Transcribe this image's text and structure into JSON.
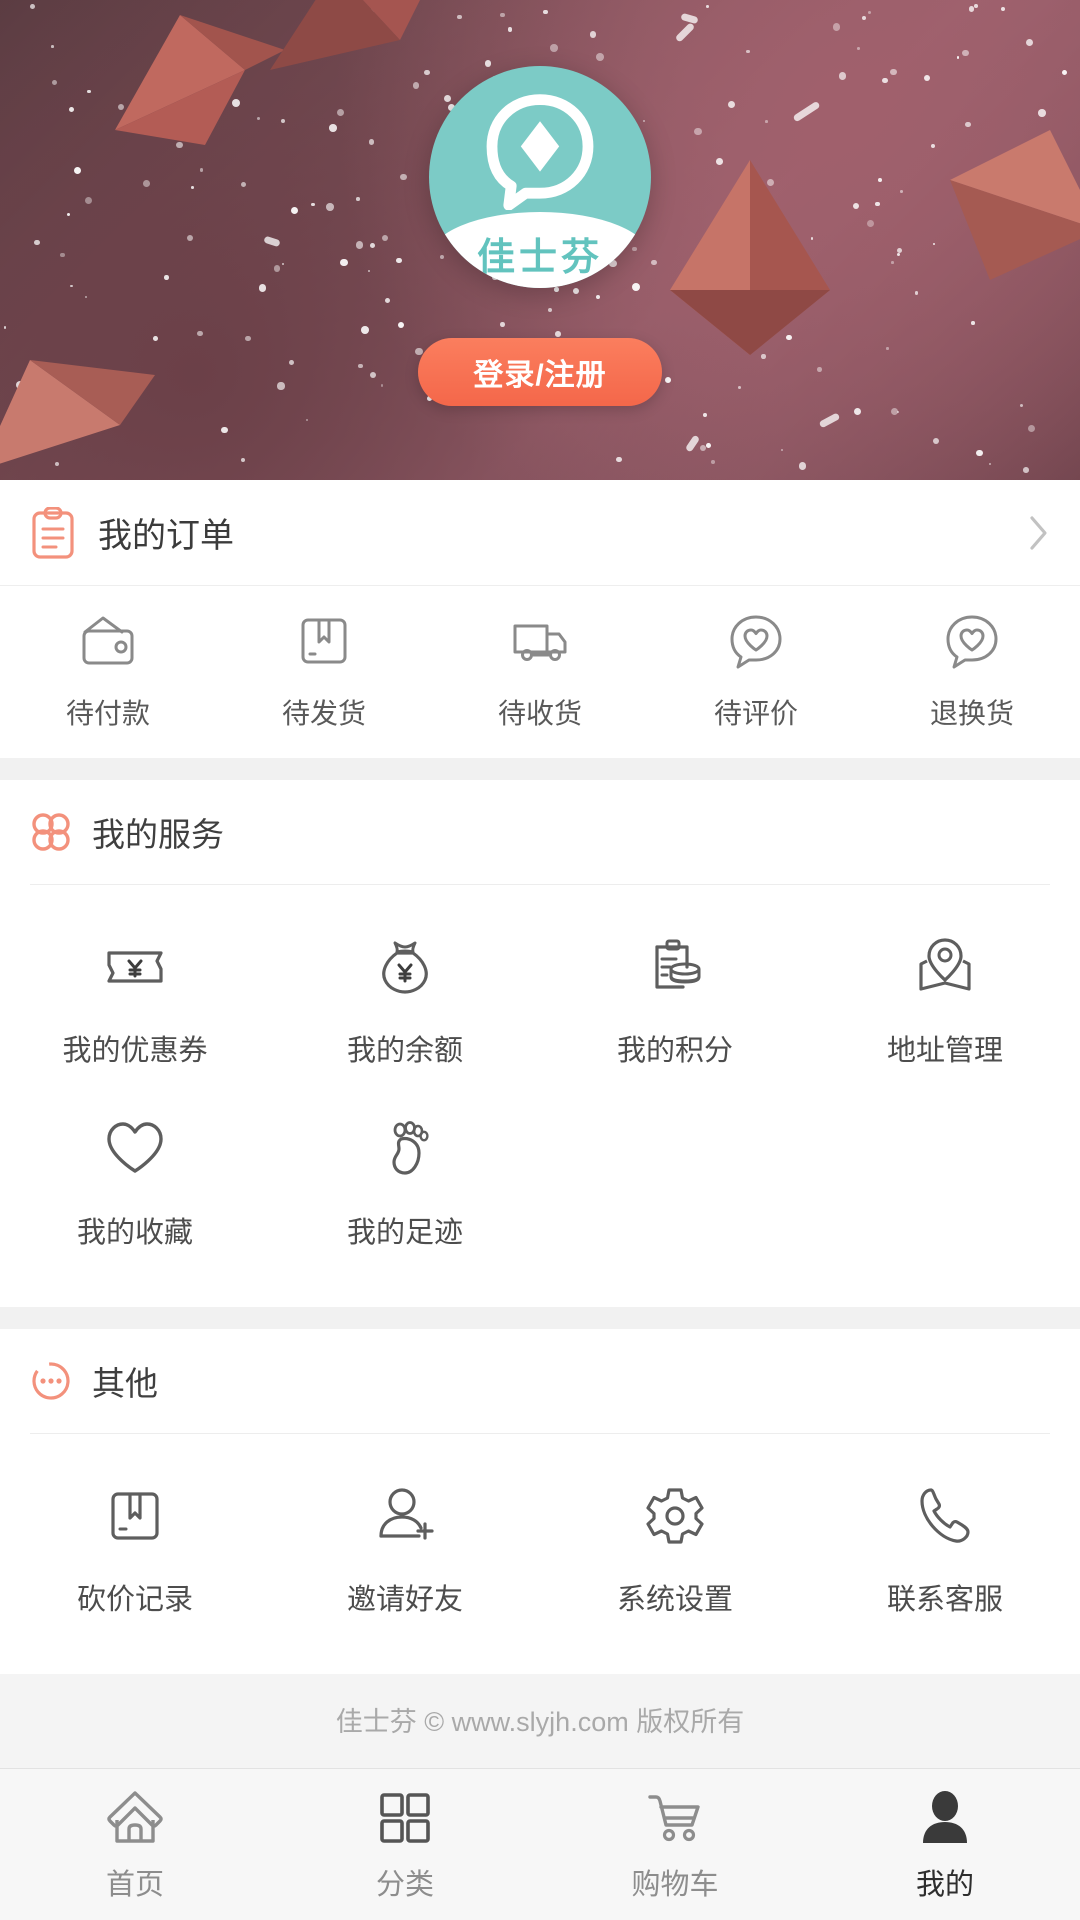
{
  "hero": {
    "logo_text": "佳士芬",
    "logo_icon": "chat-diamond-logo-icon",
    "login_label": "登录/注册",
    "brand_teal": "#7ccbc6",
    "accent_coral": "#f4674a",
    "bg_plum": "#7a4f57"
  },
  "orders": {
    "icon": "clipboard-icon",
    "label": "我的订单",
    "chevron": "chevron-right-icon",
    "statuses": [
      {
        "icon": "wallet-icon",
        "label": "待付款"
      },
      {
        "icon": "package-icon",
        "label": "待发货"
      },
      {
        "icon": "truck-icon",
        "label": "待收货"
      },
      {
        "icon": "heart-bubble-icon",
        "label": "待评价"
      },
      {
        "icon": "heart-bubble-icon",
        "label": "退换货"
      }
    ]
  },
  "services": {
    "icon": "flower-four-circles-icon",
    "title": "我的服务",
    "items": [
      {
        "icon": "coupon-ticket-icon",
        "label": "我的优惠券"
      },
      {
        "icon": "money-bag-icon",
        "label": "我的余额"
      },
      {
        "icon": "points-coins-icon",
        "label": "我的积分"
      },
      {
        "icon": "map-pin-icon",
        "label": "地址管理"
      },
      {
        "icon": "heart-icon",
        "label": "我的收藏"
      },
      {
        "icon": "footprint-icon",
        "label": "我的足迹"
      }
    ]
  },
  "other": {
    "icon": "circle-ellipsis-icon",
    "title": "其他",
    "items": [
      {
        "icon": "package-icon",
        "label": "砍价记录"
      },
      {
        "icon": "user-plus-icon",
        "label": "邀请好友"
      },
      {
        "icon": "gear-icon",
        "label": "系统设置"
      },
      {
        "icon": "phone-icon",
        "label": "联系客服"
      }
    ]
  },
  "footer": {
    "copyright": "佳士芬 © www.slyjh.com 版权所有"
  },
  "tabbar": {
    "items": [
      {
        "icon": "home-icon",
        "label": "首页",
        "active": false
      },
      {
        "icon": "grid-icon",
        "label": "分类",
        "active": false
      },
      {
        "icon": "cart-icon",
        "label": "购物车",
        "active": false
      },
      {
        "icon": "person-icon",
        "label": "我的",
        "active": true
      }
    ]
  }
}
